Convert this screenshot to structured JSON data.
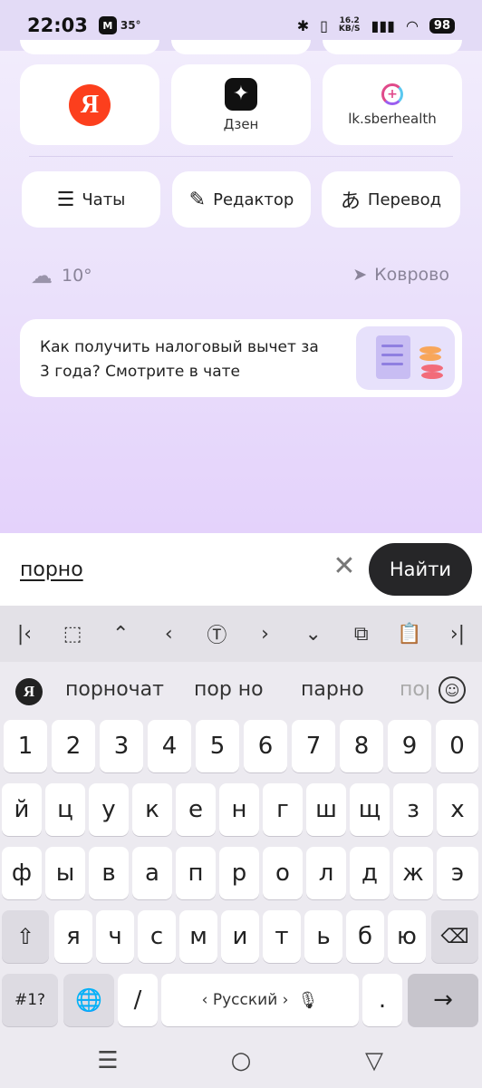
{
  "status_bar": {
    "time": "22:03",
    "notif_badge": "M",
    "temperature": "35°",
    "net_speed_value": "16.2",
    "net_speed_unit": "KB/S",
    "battery": "98"
  },
  "shortcuts": [
    {
      "name": "yandex",
      "label": "",
      "logo_text": "Я"
    },
    {
      "name": "dzen",
      "label": "Дзен",
      "logo_text": "✦"
    },
    {
      "name": "sberhealth",
      "label": "lk.sberhealth",
      "logo_text": "+"
    }
  ],
  "actions": {
    "chats": "Чаты",
    "editor": "Редактор",
    "translate": "Перевод"
  },
  "weather": {
    "temp": "10°",
    "city": "Коврово"
  },
  "promo": {
    "text": "Как получить налоговый вычет за 3 года? Смотрите в чате"
  },
  "search": {
    "query": "порно",
    "find_label": "Найти",
    "clear_glyph": "✕"
  },
  "keyboard": {
    "suggestions": [
      "порночат",
      "пор но",
      "парно",
      "пор"
    ],
    "number_row": [
      "1",
      "2",
      "3",
      "4",
      "5",
      "6",
      "7",
      "8",
      "9",
      "0"
    ],
    "row1": [
      "й",
      "ц",
      "у",
      "к",
      "е",
      "н",
      "г",
      "ш",
      "щ",
      "з",
      "х"
    ],
    "row2": [
      "ф",
      "ы",
      "в",
      "а",
      "п",
      "р",
      "о",
      "л",
      "д",
      "ж",
      "э"
    ],
    "row3": [
      "я",
      "ч",
      "с",
      "м",
      "и",
      "т",
      "ь",
      "б",
      "ю"
    ],
    "symbols_label": "#1?",
    "language_label": "‹ Русский ›",
    "comma": "/",
    "period": "."
  },
  "icons": {
    "edit_toolbar": [
      "first-icon",
      "select-icon",
      "up-icon",
      "left-icon",
      "cursor-text-icon",
      "right-icon",
      "down-icon",
      "copy-icon",
      "paste-icon",
      "last-icon"
    ]
  }
}
